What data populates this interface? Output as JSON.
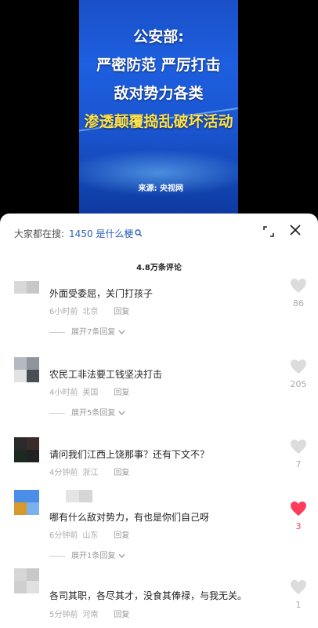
{
  "video": {
    "line1": "公安部:",
    "line2": "严密防范 严厉打击",
    "line3": "敌对势力各类",
    "line4": "渗透颠覆捣乱破坏活动",
    "source": "来源: 央视网"
  },
  "search": {
    "label": "大家都在搜:",
    "query": "1450 是什么梗"
  },
  "comment_count": "4.8万条评论",
  "comments": [
    {
      "text": "外面受委屈，关门打孩子",
      "time": "6小时前",
      "location": "北京",
      "reply": "回复",
      "expand": "展开7条回复",
      "likes": "86",
      "liked": false
    },
    {
      "text": "农民工非法要工钱坚决打击",
      "time": "4小时前",
      "location": "美国",
      "reply": "回复",
      "expand": "展开5条回复",
      "likes": "205",
      "liked": false
    },
    {
      "text": "请问我们江西上饶那事？还有下文不？",
      "time": "4分钟前",
      "location": "浙江",
      "reply": "回复",
      "likes": "7",
      "liked": false
    },
    {
      "text": "哪有什么敌对势力，有也是你们自己呀",
      "time": "6分钟前",
      "location": "山东",
      "reply": "回复",
      "expand": "展开1条回复",
      "likes": "3",
      "liked": true
    },
    {
      "text": "各司其职，各尽其才，没食其俸禄，与我无关。",
      "time": "5分钟前",
      "location": "河南",
      "reply": "回复",
      "likes": "1",
      "liked": false
    }
  ],
  "colors": {
    "link": "#2b5fb8",
    "like_active": "#ff3b5c",
    "video_blue": "#1d5fe0",
    "headline_yellow": "#ffe24a"
  }
}
